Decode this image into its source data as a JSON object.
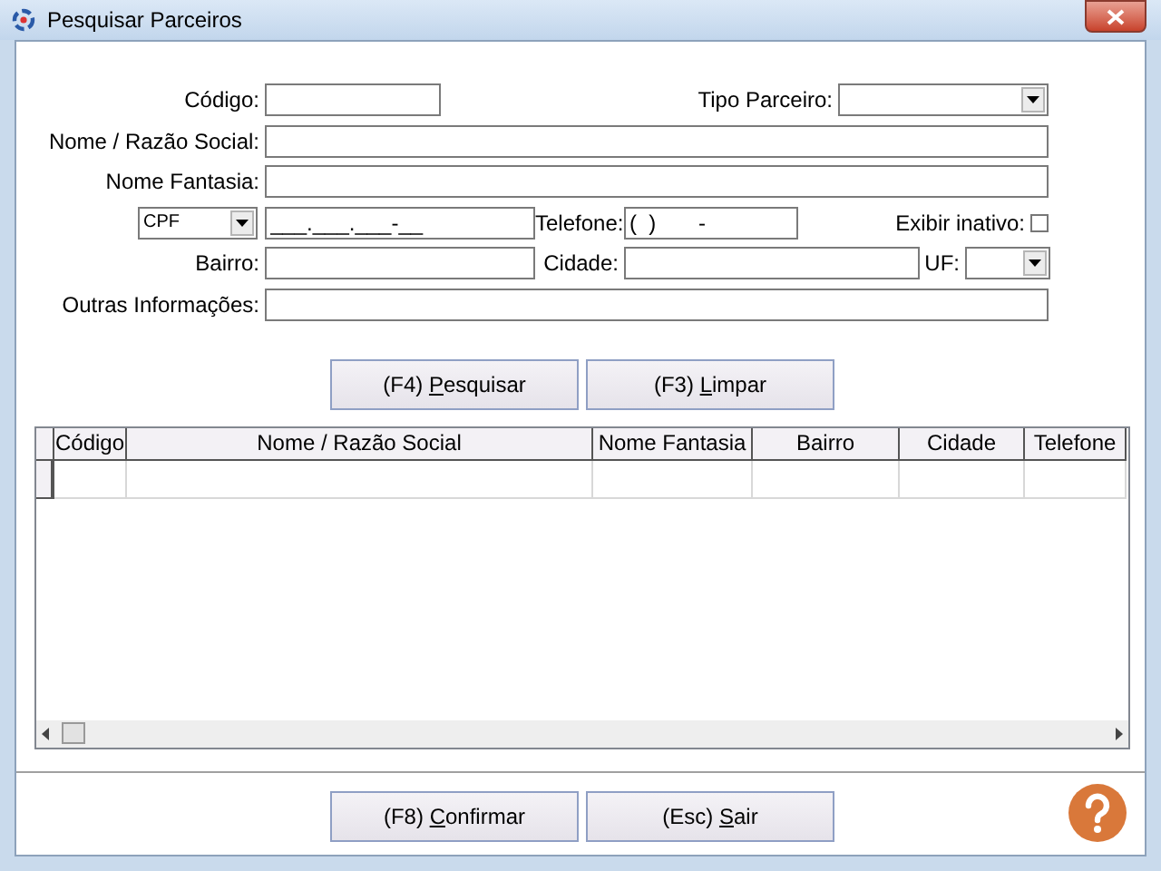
{
  "window": {
    "title": "Pesquisar Parceiros"
  },
  "form": {
    "codigo": {
      "label": "Código:"
    },
    "tipo_parceiro": {
      "label": "Tipo Parceiro:"
    },
    "nome_razao_social": {
      "label": "Nome / Razão Social:"
    },
    "nome_fantasia": {
      "label": "Nome Fantasia:"
    },
    "documento": {
      "type": "CPF",
      "value": "___.___.___-__"
    },
    "telefone": {
      "label": "Telefone:",
      "value": "(  )       -"
    },
    "exibir_inativo": {
      "label": "Exibir inativo:",
      "checked": false
    },
    "bairro": {
      "label": "Bairro:"
    },
    "cidade": {
      "label": "Cidade:"
    },
    "uf": {
      "label": "UF:"
    },
    "outras_informacoes": {
      "label": "Outras Informações:"
    }
  },
  "search_buttons": [
    {
      "before": "(F4) ",
      "key": "P",
      "after": "esquisar"
    },
    {
      "before": "(F3) ",
      "key": "L",
      "after": "impar"
    }
  ],
  "table": {
    "columns": [
      "Código",
      "Nome / Razão Social",
      "Nome Fantasia",
      "Bairro",
      "Cidade",
      "Telefone"
    ]
  },
  "footer_buttons": [
    {
      "before": "(F8) ",
      "key": "C",
      "after": "onfirmar"
    },
    {
      "before": "(Esc) ",
      "key": "S",
      "after": "air"
    }
  ]
}
